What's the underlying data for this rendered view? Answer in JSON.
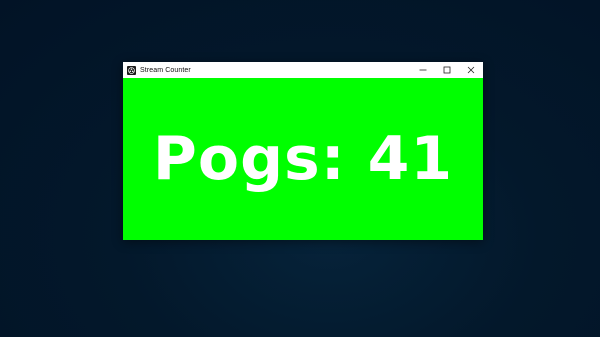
{
  "window": {
    "title": "Stream Counter",
    "app_icon": "obs-app-icon",
    "background_color": "#00ff00",
    "controls": {
      "minimize_icon": "minimize-icon",
      "maximize_icon": "maximize-icon",
      "close_icon": "close-icon"
    }
  },
  "counter": {
    "text": "Pogs: 41",
    "label": "Pogs",
    "value": 41,
    "color": "#ffffff"
  },
  "desktop": {
    "background_color": "#021326"
  }
}
